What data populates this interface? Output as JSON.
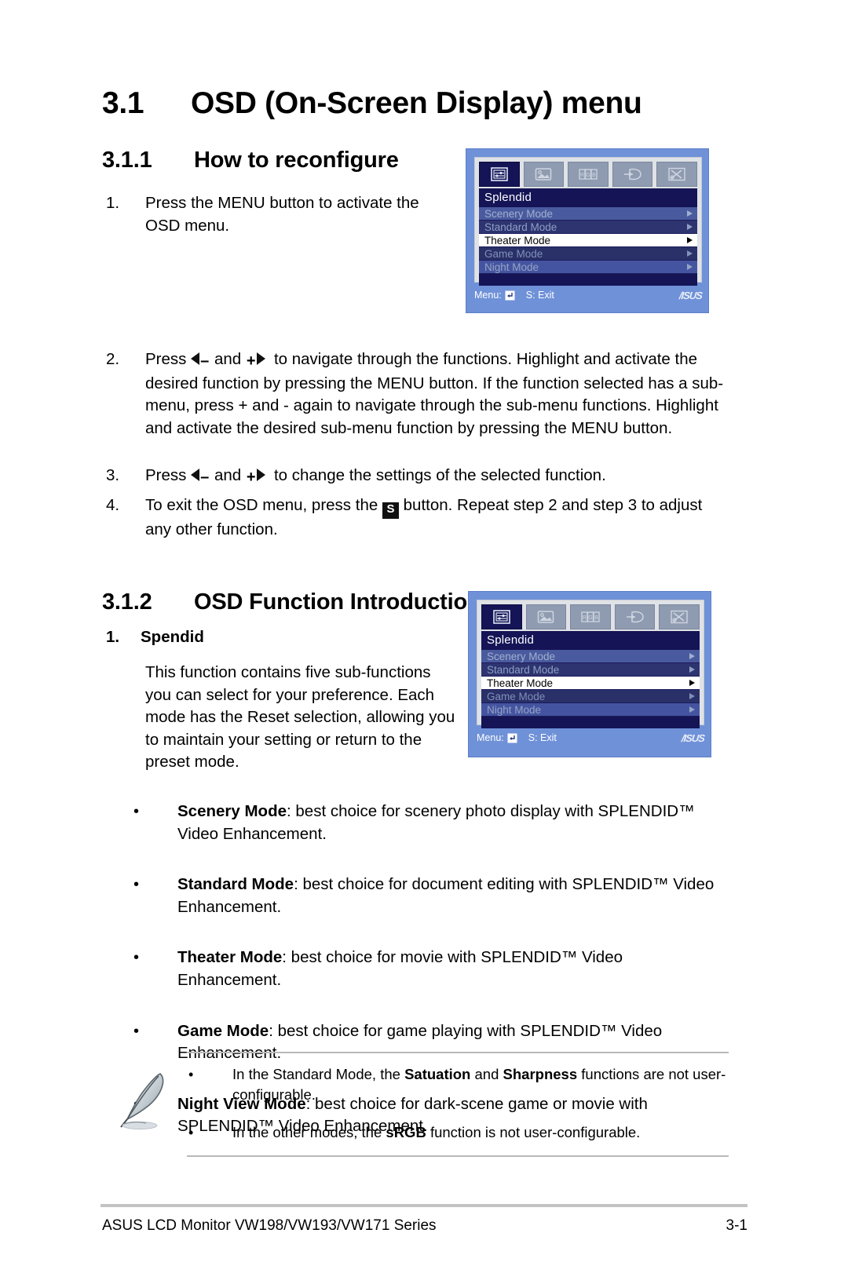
{
  "section": {
    "number": "3.1",
    "title": "OSD (On-Screen Display) menu"
  },
  "subsections": [
    {
      "number": "3.1.1",
      "title": "How to reconfigure"
    },
    {
      "number": "3.1.2",
      "title": "OSD Function Introduction"
    }
  ],
  "steps": [
    {
      "index": "1.",
      "text": "Press the MENU button to activate the OSD menu."
    },
    {
      "index": "2.",
      "text_before": "Press",
      "text_middle": "and",
      "text_after": "to navigate through the functions. Highlight and activate the desired function by pressing the MENU button. If the function selected has a sub-menu, press + and - again to navigate through the sub-menu functions. Highlight and activate the desired sub-menu function by pressing the MENU button."
    },
    {
      "index": "3.",
      "text_before": "Press",
      "text_middle": "and",
      "text_after": "to change the settings of the selected function."
    },
    {
      "index": "4.",
      "text_before": "To exit the OSD menu, press the",
      "text_after": "button. Repeat step 2 and step 3 to adjust any other function."
    }
  ],
  "glyphs": {
    "minus": "–",
    "plus": "+",
    "s_button": "S"
  },
  "spendid": {
    "index": "1.",
    "title": "Spendid",
    "paragraph": "This function contains five sub-functions you can select for your preference. Each mode has the Reset selection, allowing you to maintain your setting or return to the preset mode."
  },
  "mode_bullets": [
    {
      "bullet": "•",
      "term": "Scenery Mode",
      "description": ": best choice for scenery photo display with SPLENDID™ Video Enhancement."
    },
    {
      "bullet": "•",
      "term": "Standard Mode",
      "description": ": best choice for document editing with SPLENDID™ Video Enhancement."
    },
    {
      "bullet": "•",
      "term": "Theater Mode",
      "description": ": best choice for movie with SPLENDID™ Video Enhancement."
    },
    {
      "bullet": "•",
      "term": "Game Mode",
      "description": ": best choice for game playing with SPLENDID™ Video Enhancement."
    },
    {
      "bullet": "•",
      "term": "Night View Mode",
      "description": ": best choice for dark-scene game or movie with SPLENDID™ Video Enhancement."
    }
  ],
  "note": {
    "icon": "pencil-icon",
    "items": [
      {
        "bullet": "•",
        "part1": "In the Standard Mode, the ",
        "bold1": "Satuation",
        "part2": " and ",
        "bold2": "Sharpness",
        "part3": " functions are not user-configurable."
      },
      {
        "bullet": "•",
        "part1": "In the other modes, the ",
        "bold1": "sRGB",
        "part2": "",
        "bold2": "",
        "part3": " function is not user-configurable."
      }
    ]
  },
  "osd": {
    "tabs": [
      {
        "name": "splendid-tab",
        "active": true
      },
      {
        "name": "image-tab",
        "active": false
      },
      {
        "name": "color-tab",
        "active": false
      },
      {
        "name": "input-select-tab",
        "active": false
      },
      {
        "name": "system-setup-tab",
        "active": false
      }
    ],
    "title": "Splendid",
    "rows": [
      {
        "label": "Scenery Mode",
        "selected": false
      },
      {
        "label": "Standard Mode",
        "selected": false
      },
      {
        "label": "Theater Mode",
        "selected": true
      },
      {
        "label": "Game Mode",
        "selected": false
      },
      {
        "label": "Night Mode",
        "selected": false
      }
    ],
    "footer": {
      "menu_label": "Menu:",
      "exit_label": "S: Exit",
      "brand": "/ISUS"
    },
    "colors": {
      "frame": "#6f91d8",
      "inner": "#dfe2e6",
      "title_bar": "#141456",
      "tab_active": "#141456",
      "tab_inactive": "#8f9bb0",
      "row_selected_bg": "#ffffff",
      "row_text": "#9fb0cf"
    }
  },
  "footer": {
    "left": "ASUS LCD Monitor VW198/VW193/VW171 Series",
    "right": "3-1"
  }
}
